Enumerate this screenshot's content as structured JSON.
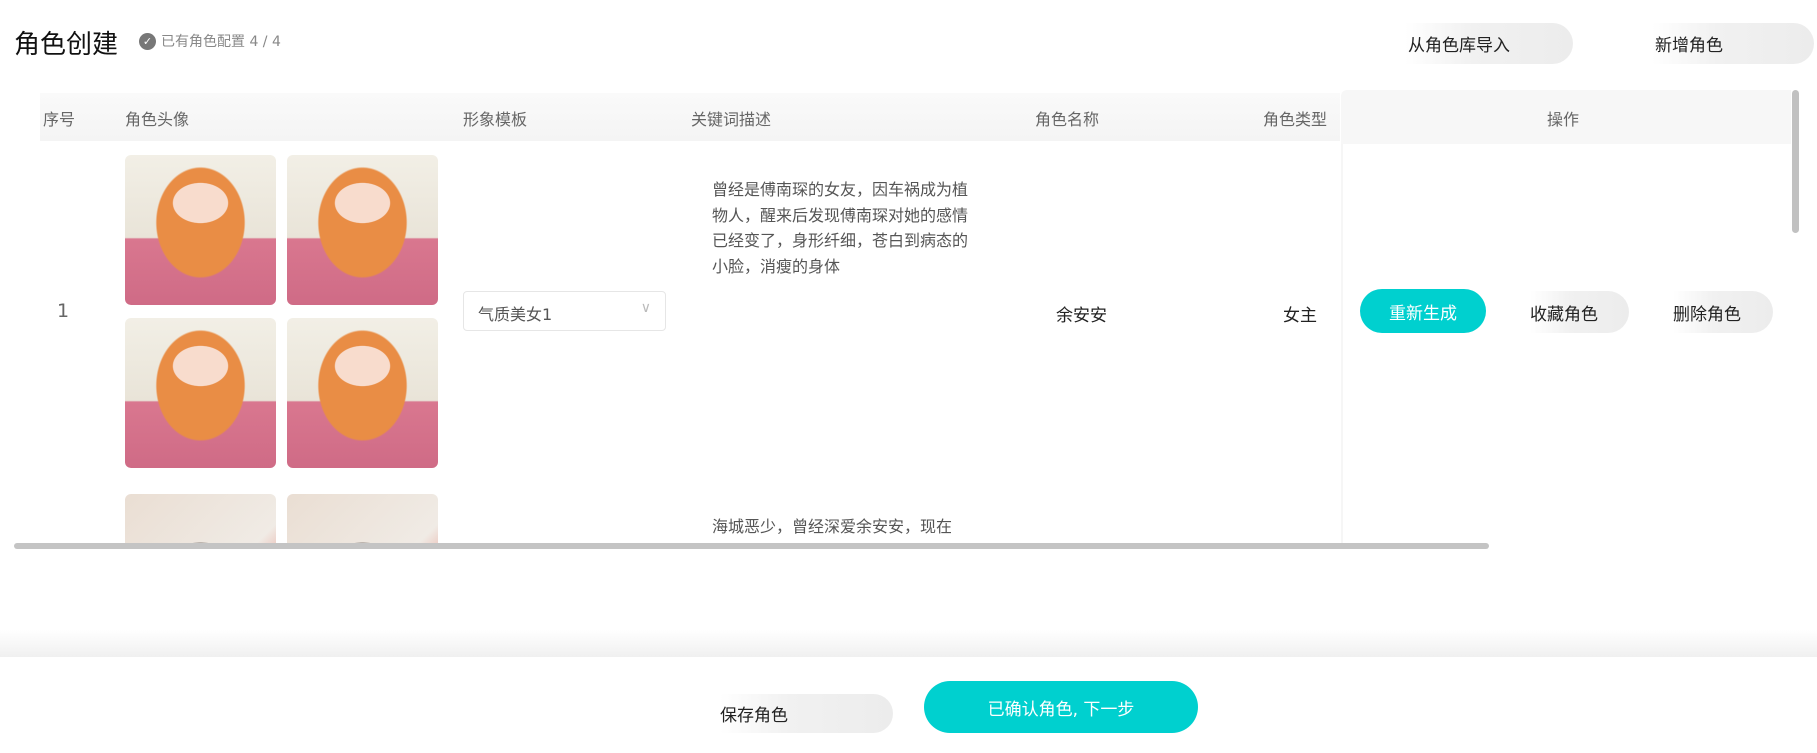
{
  "header": {
    "title": "角色创建",
    "badge_text": "已有角色配置 4 / 4",
    "badge_icon": "check-circle-icon",
    "import_label": "从角色库导入",
    "add_label": "新增角色"
  },
  "table": {
    "columns": [
      "序号",
      "角色头像",
      "形象模板",
      "关键词描述",
      "角色名称",
      "角色类型",
      "操作"
    ],
    "rows": [
      {
        "index": "1",
        "template": "气质美女1",
        "description": "曾经是傅南琛的女友，因车祸成为植物人，醒来后发现傅南琛对她的感情已经变了，身形纤细，苍白到病态的小脸，消瘦的身体",
        "name": "余安安",
        "type": "女主",
        "actions": {
          "regenerate": "重新生成",
          "favorite": "收藏角色",
          "delete": "删除角色"
        }
      },
      {
        "description": "海城恶少，曾经深爱余安安，现在"
      }
    ]
  },
  "footer": {
    "save_label": "保存角色",
    "confirm_label": "已确认角色, 下一步"
  },
  "colors": {
    "accent": "#00d0cf"
  }
}
